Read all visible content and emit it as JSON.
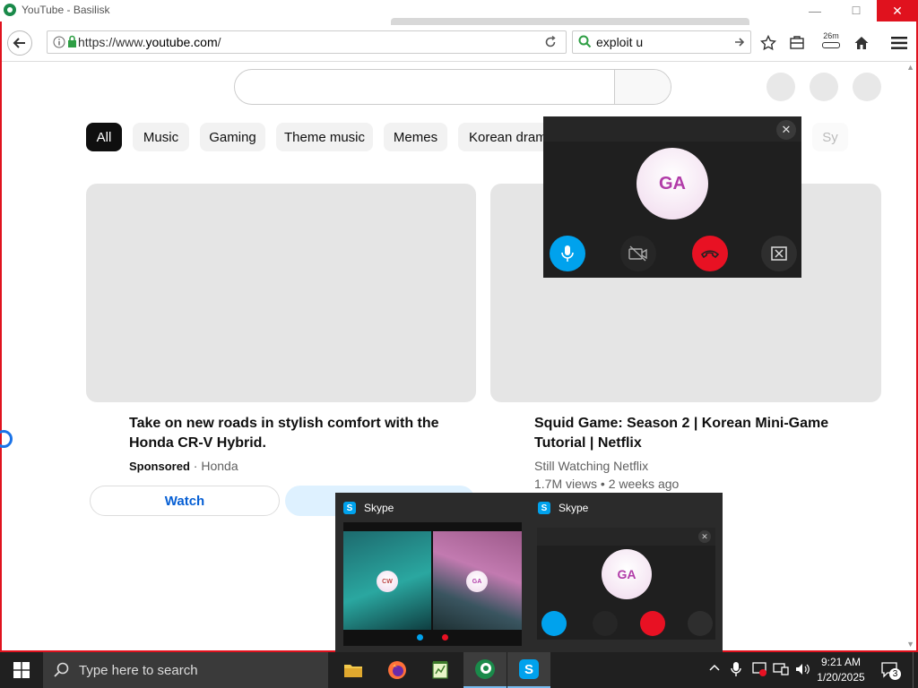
{
  "window": {
    "title": "YouTube - Basilisk",
    "minimize": "—",
    "maximize": "☐",
    "close": "✕"
  },
  "nav": {
    "url_prefix": "https://www.",
    "url_host": "youtube.com",
    "url_suffix": "/",
    "search_value": "exploit u",
    "timer": "26m"
  },
  "chips": [
    "All",
    "Music",
    "Gaming",
    "Theme music",
    "Memes",
    "Korean drama",
    "Sy"
  ],
  "videos": [
    {
      "title_l1": "Take on new roads in stylish comfort with the",
      "title_l2": "Honda CR-V Hybrid.",
      "sponsored": "Sponsored",
      "channel": "· Honda",
      "cta": "Watch"
    },
    {
      "title_l1": "Squid Game: Season 2 | Korean Mini-Game",
      "title_l2": "Tutorial | Netflix",
      "channel": "Still Watching Netflix",
      "stats": "1.7M views • 2 weeks ago"
    }
  ],
  "call": {
    "avatar": "GA",
    "close": "✕"
  },
  "preview": {
    "left_label": "Skype",
    "right_label": "Skype",
    "left_avatar_1": "CW",
    "left_avatar_2": "GA",
    "right_avatar": "GA",
    "close": "✕"
  },
  "taskbar": {
    "search_placeholder": "Type here to search",
    "time": "9:21 AM",
    "date": "1/20/2025",
    "notifications": "3"
  },
  "colors": {
    "accent_red": "#e0121e",
    "skype_blue": "#00a2ed",
    "yt_link": "#065fd4"
  }
}
